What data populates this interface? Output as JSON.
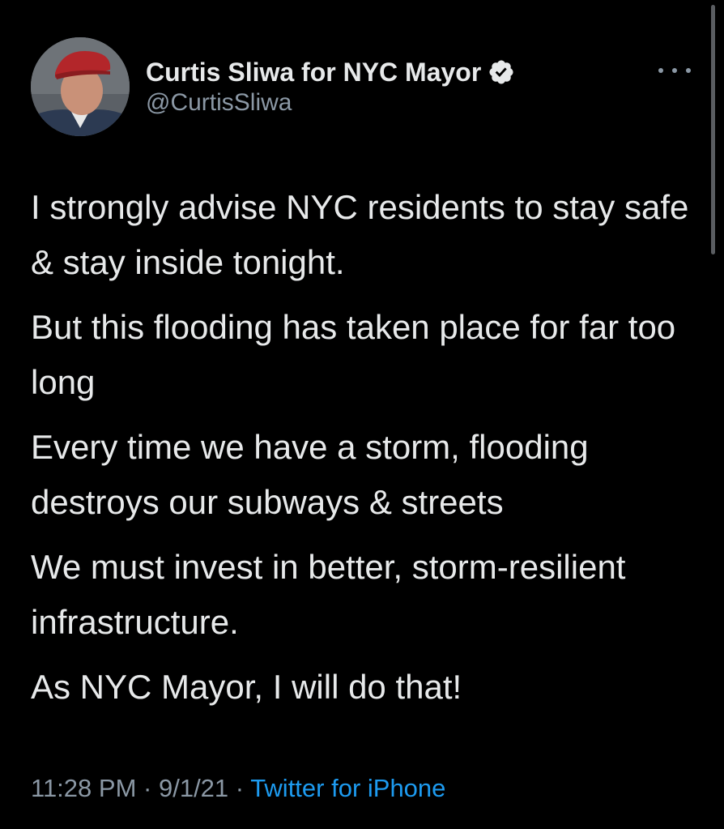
{
  "author": {
    "display_name": "Curtis Sliwa for NYC Mayor",
    "handle": "@CurtisSliwa",
    "verified": true,
    "avatar_icon": "profile-photo",
    "verified_icon": "verified-badge-icon"
  },
  "menu": {
    "icon": "more-options-icon"
  },
  "tweet": {
    "paragraphs": [
      "I strongly advise NYC residents to stay safe & stay inside tonight.",
      "But this flooding has taken place for far too long",
      "Every time we have a storm, flooding destroys our subways & streets",
      "We must invest in better, storm-resilient infrastructure.",
      "As NYC Mayor, I will do that!"
    ],
    "time": "11:28 PM",
    "separator": "·",
    "date": "9/1/21",
    "source": "Twitter for iPhone"
  },
  "colors": {
    "background": "#000000",
    "text_primary": "#e7e9ea",
    "text_secondary": "#8b98a5",
    "link": "#1d9bf0",
    "beret": "#b3262a"
  }
}
